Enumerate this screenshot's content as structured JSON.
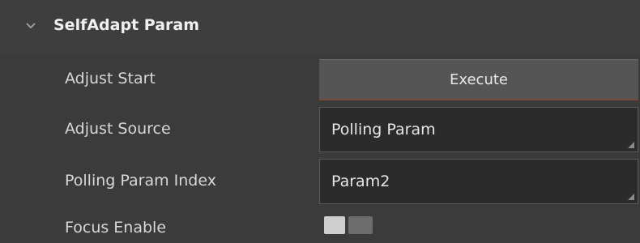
{
  "section": {
    "title": "SelfAdapt Param",
    "icon": "chevron-down-icon"
  },
  "rows": [
    {
      "label": "Adjust Start",
      "control": "button",
      "value": "Execute"
    },
    {
      "label": "Adjust Source",
      "control": "combo",
      "value": "Polling Param"
    },
    {
      "label": "Polling Param Index",
      "control": "combo",
      "value": "Param2"
    },
    {
      "label": "Focus Enable",
      "control": "toggle",
      "value": "off"
    }
  ],
  "colors": {
    "background": "#3b3b3b",
    "field": "#2b2b2b",
    "button": "#555555",
    "accent_border": "#7a4a38"
  }
}
